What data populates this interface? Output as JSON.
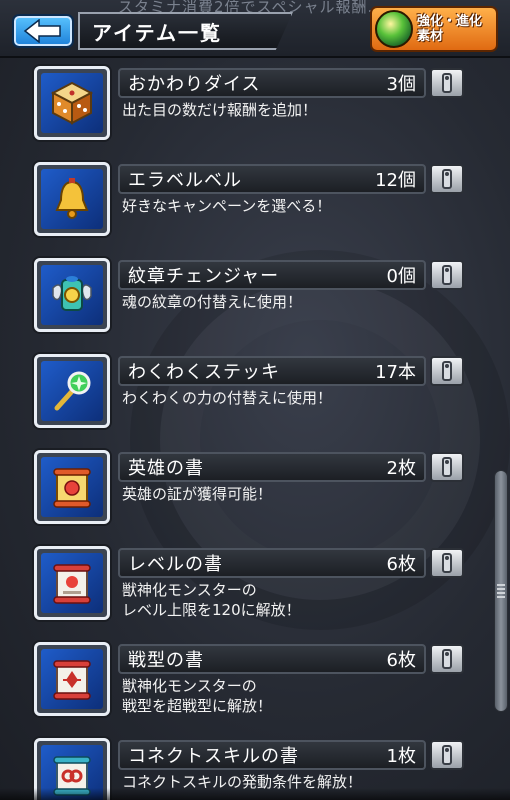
{
  "header": {
    "ticker": "スタミナ消費2倍でスペシャル報酬…",
    "title": "アイテム一覧",
    "materials_button": "強化・進化\n素材"
  },
  "items": [
    {
      "name": "おかわりダイス",
      "count": "3個",
      "desc": "出た目の数だけ報酬を追加！",
      "icon": "dice-icon"
    },
    {
      "name": "エラベルベル",
      "count": "12個",
      "desc": "好きなキャンペーンを選べる！",
      "icon": "bell-icon"
    },
    {
      "name": "紋章チェンジャー",
      "count": "0個",
      "desc": "魂の紋章の付替えに使用！",
      "icon": "crest-changer-icon"
    },
    {
      "name": "わくわくステッキ",
      "count": "17本",
      "desc": "わくわくの力の付替えに使用！",
      "icon": "wand-icon"
    },
    {
      "name": "英雄の書",
      "count": "2枚",
      "desc": "英雄の証が獲得可能！",
      "icon": "hero-scroll-icon"
    },
    {
      "name": "レベルの書",
      "count": "6枚",
      "desc": "獣神化モンスターの\nレベル上限を120に解放！",
      "icon": "level-scroll-icon"
    },
    {
      "name": "戦型の書",
      "count": "6枚",
      "desc": "獣神化モンスターの\n戦型を超戦型に解放！",
      "icon": "battle-type-scroll-icon"
    },
    {
      "name": "コネクトスキルの書",
      "count": "1枚",
      "desc": "コネクトスキルの発動条件を解放！",
      "icon": "connect-scroll-icon"
    }
  ]
}
